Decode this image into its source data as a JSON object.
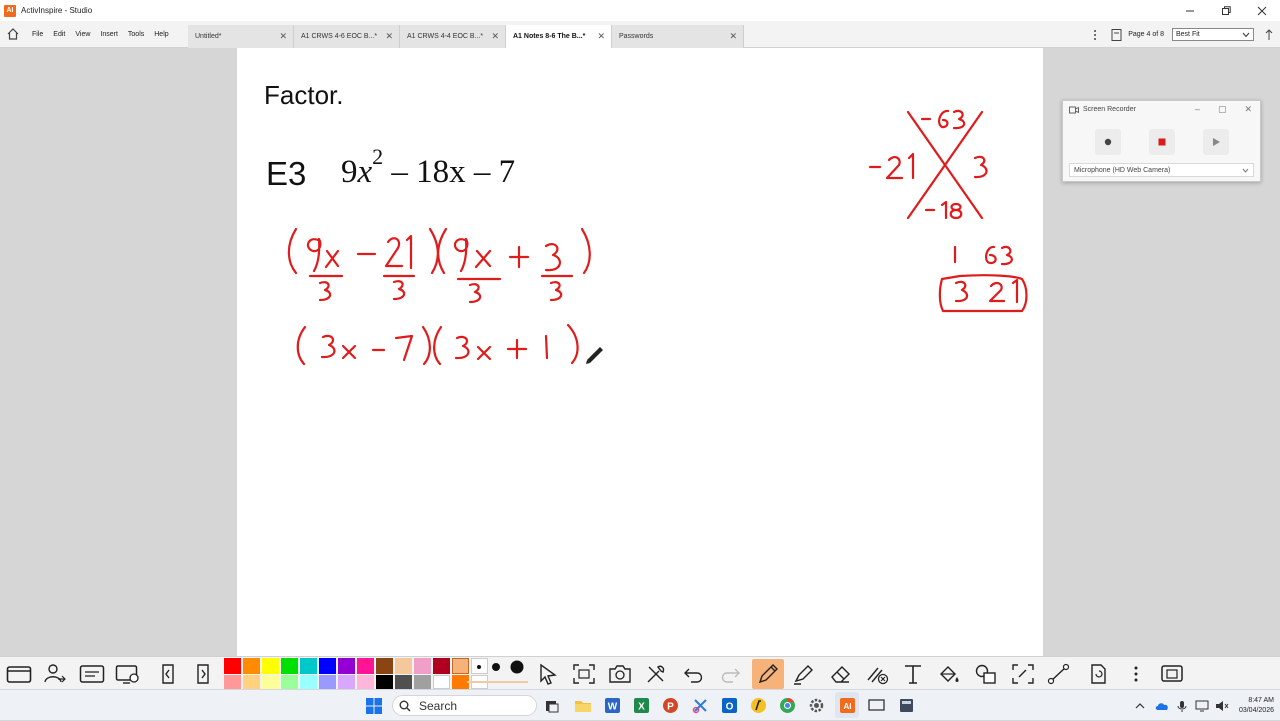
{
  "window": {
    "title": "ActivInspire - Studio",
    "app_logo_text": "AI"
  },
  "menu": {
    "items": [
      "File",
      "Edit",
      "View",
      "Insert",
      "Tools",
      "Help"
    ]
  },
  "tabs": [
    {
      "label": "Untitled*",
      "active": false
    },
    {
      "label": "A1 CRWS 4-6 EOC B...*",
      "active": false
    },
    {
      "label": "A1 CRWS 4-4 EOC B...*",
      "active": false
    },
    {
      "label": "A1 Notes 8-6 The B...*",
      "active": true
    },
    {
      "label": "Passwords",
      "active": false
    }
  ],
  "page_indicator": "Page 4 of 8",
  "zoom": {
    "selected": "Best Fit"
  },
  "flipchart": {
    "heading": "Factor.",
    "problem_label": "E3",
    "expression": {
      "coef": "9",
      "var": "x",
      "exp": "2",
      "rest": " – 18x – 7"
    }
  },
  "screen_recorder": {
    "title": "Screen Recorder",
    "microphone": "Microphone (HD Web Camera)"
  },
  "taskbar": {
    "search_placeholder": "Search",
    "clock_time": "8:47 AM",
    "clock_date": "03/04/2026"
  },
  "colors": {
    "ink": "#e01b1b",
    "accent_orange": "#f26b1d",
    "active_tool": "#f7b27a"
  },
  "palette": {
    "row1": [
      "#ff0000",
      "#ff8c00",
      "#ffff00",
      "#00e000",
      "#00c8c8",
      "#0000ff",
      "#9400d3",
      "#ff1493",
      "#8b4513",
      "#f4c89a",
      "#f0a0c8",
      "#b00020",
      "#f7b27a",
      "#ffffff"
    ],
    "row2": [
      "#ff9999",
      "#ffd27f",
      "#ffff99",
      "#99ff99",
      "#99ffff",
      "#9999ff",
      "#d8a8ff",
      "#ffb6d9",
      "#000000",
      "#505050",
      "#a0a0a0",
      "#ffffff",
      "#ff7a00",
      "#ffffff"
    ]
  }
}
